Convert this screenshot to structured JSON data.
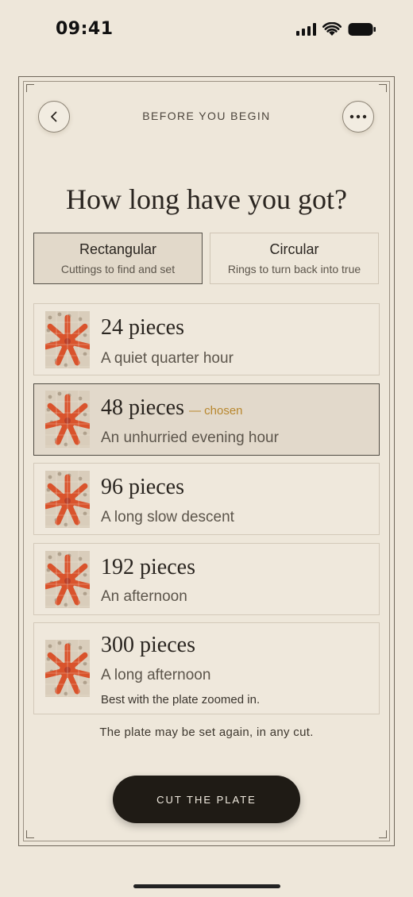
{
  "status_bar": {
    "time": "09:41"
  },
  "header": {
    "title": "BEFORE YOU BEGIN"
  },
  "headline": "How long have you got?",
  "cut_modes": [
    {
      "title": "Rectangular",
      "subtitle": "Cuttings to find and set",
      "selected": true
    },
    {
      "title": "Circular",
      "subtitle": "Rings to turn back into true",
      "selected": false
    }
  ],
  "options": [
    {
      "title": "24 pieces",
      "subtitle": "A quiet quarter hour",
      "selected": false
    },
    {
      "title": "48 pieces",
      "subtitle": "An unhurried evening hour",
      "selected": true,
      "badge": "— chosen"
    },
    {
      "title": "96 pieces",
      "subtitle": "A long slow descent",
      "selected": false
    },
    {
      "title": "192 pieces",
      "subtitle": "An afternoon",
      "selected": false
    },
    {
      "title": "300 pieces",
      "subtitle": "A long afternoon",
      "note": "Best with the plate zoomed in.",
      "selected": false
    }
  ],
  "footnote": "The plate may be set again, in any cut.",
  "cta_label": "CUT THE PLATE",
  "colors": {
    "accent": "#b8872e",
    "ink": "#2a2520",
    "paper": "#eee7da",
    "button": "#1f1b15",
    "starfish": "#d9532c"
  },
  "icons": {
    "back": "chevron-left-icon",
    "more": "more-dots-icon",
    "thumbnail": "starfish-thumbnail"
  }
}
